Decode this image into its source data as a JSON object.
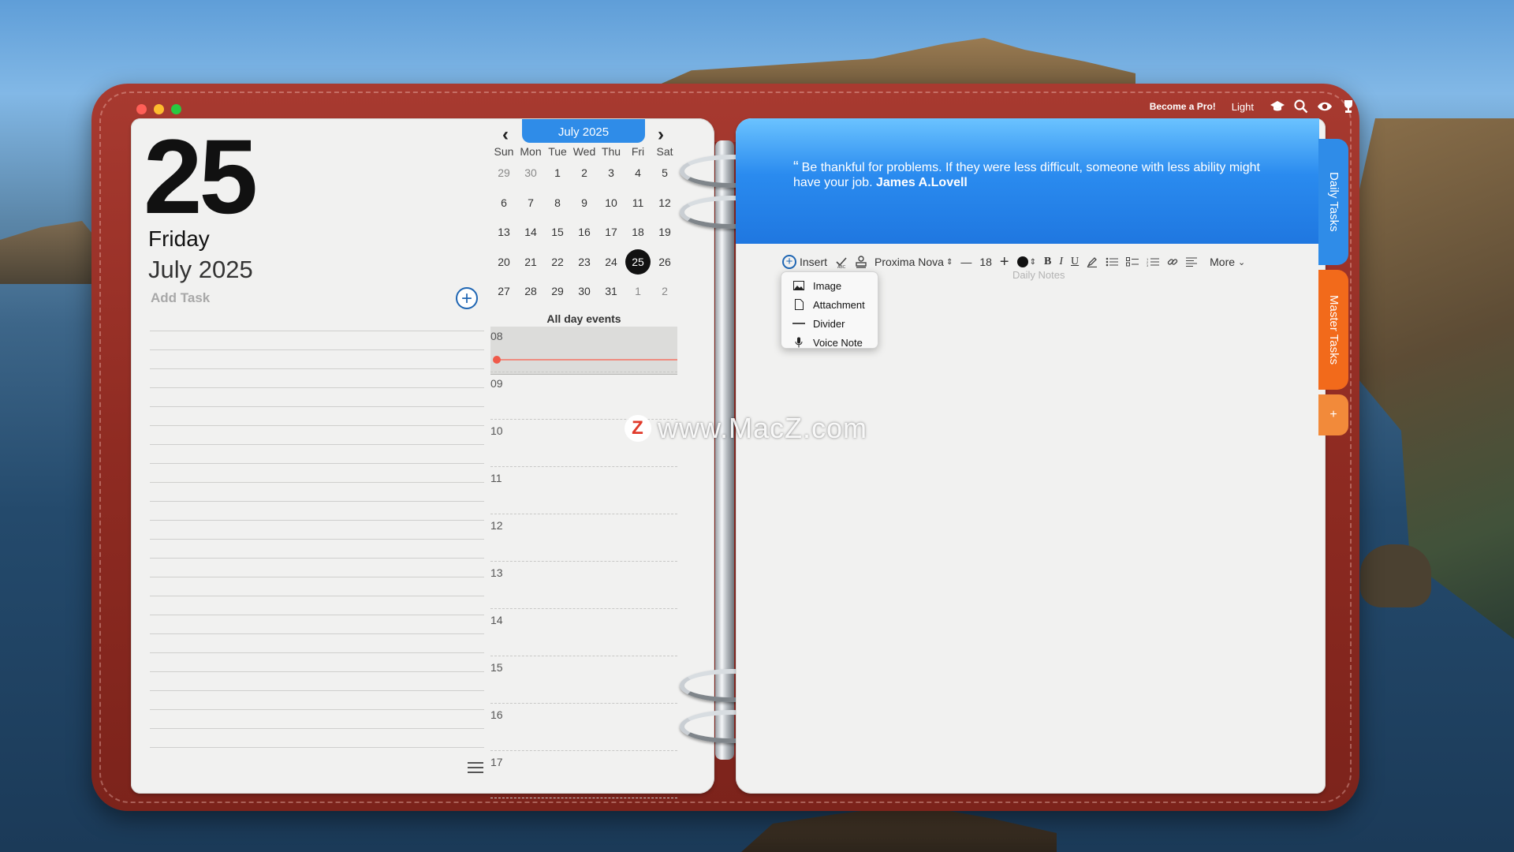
{
  "topbar": {
    "pro_label": "Become a Pro!",
    "theme_label": "Light"
  },
  "left_page": {
    "day_number": "25",
    "weekday": "Friday",
    "month_year": "July 2025",
    "add_task_placeholder": "Add Task",
    "add_button": "+"
  },
  "calendar": {
    "month_label": "July 2025",
    "prev": "‹",
    "next": "›",
    "weekdays": [
      "Sun",
      "Mon",
      "Tue",
      "Wed",
      "Thu",
      "Fri",
      "Sat"
    ],
    "weeks": [
      [
        "29",
        "30",
        "1",
        "2",
        "3",
        "4",
        "5"
      ],
      [
        "6",
        "7",
        "8",
        "9",
        "10",
        "11",
        "12"
      ],
      [
        "13",
        "14",
        "15",
        "16",
        "17",
        "18",
        "19"
      ],
      [
        "20",
        "21",
        "22",
        "23",
        "24",
        "25",
        "26"
      ],
      [
        "27",
        "28",
        "29",
        "30",
        "31",
        "1",
        "2"
      ]
    ],
    "selected_day": "25",
    "all_day_label": "All day events",
    "hours": [
      "08",
      "09",
      "10",
      "11",
      "12",
      "13",
      "14",
      "15",
      "16",
      "17"
    ]
  },
  "right_page": {
    "quote_text": "Be thankful for problems. If they were less difficult, someone with less ability might have your job.",
    "quote_author": "James A.Lovell",
    "placeholder": "Daily Notes"
  },
  "toolbar": {
    "insert_label": "Insert",
    "font_name": "Proxima Nova",
    "font_size": "18",
    "more_label": "More"
  },
  "insert_menu": {
    "items": [
      "Image",
      "Attachment",
      "Divider",
      "Voice Note"
    ]
  },
  "tabs": {
    "daily": "Daily Tasks",
    "master": "Master Tasks",
    "add": "+"
  },
  "watermark": {
    "text": "www.MacZ.com",
    "logo": "Z"
  },
  "colors": {
    "accent_blue": "#2f8ce8",
    "tab_orange": "#f26a1b",
    "binder_red": "#8f2b22"
  }
}
